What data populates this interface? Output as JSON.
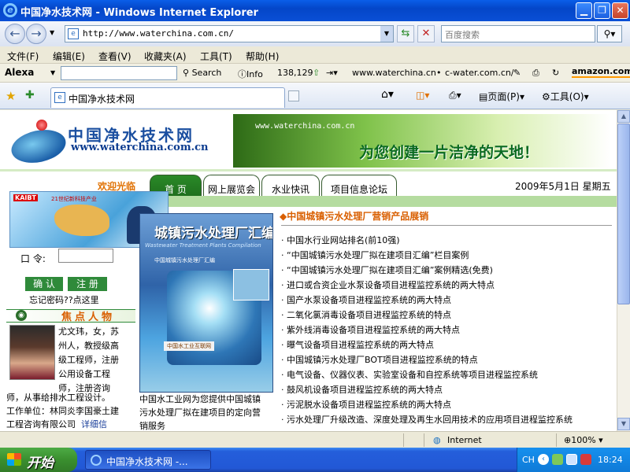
{
  "window": {
    "title": "中国净水技术网 - Windows Internet Explorer",
    "minimize_icon": "minimize-icon",
    "maximize_icon": "restore-icon",
    "close_icon": "close-icon"
  },
  "address": {
    "url": "http://www.waterchina.com.cn/",
    "search_placeholder": "百度搜索"
  },
  "menu": [
    "文件(F)",
    "编辑(E)",
    "查看(V)",
    "收藏夹(A)",
    "工具(T)",
    "帮助(H)"
  ],
  "alexa_bar": {
    "brand": "Alexa",
    "search_label": "Search",
    "info_label": "Info",
    "rank": "138,129",
    "site1": "www.waterchina.cn",
    "site2": "c-water.com.cn/",
    "amazon": "amazon.com."
  },
  "tabs": [
    {
      "label": "中国净水技术网",
      "active": true
    }
  ],
  "command_bar": {
    "page": "页面(P)",
    "tools": "工具(O)"
  },
  "page": {
    "logo_cn": "中国净水技术网",
    "logo_en": "www.waterchina.com.cn",
    "banner_url": "www.waterchina.com.cn",
    "banner_slogan": "为您创建一片洁净的天地！",
    "welcome": "欢迎光临",
    "nav": [
      "首 页",
      "网上展览会",
      "水业快讯",
      "项目信息论坛"
    ],
    "date": "2009年5月1日  星期五",
    "ad": {
      "tag": "KAIBT",
      "text": "21世纪新科技产业"
    },
    "login": {
      "password_label": "口  令:",
      "confirm": "确 认",
      "register": "注 册",
      "forgot": "忘记密码??点这里"
    },
    "focus_title": "焦点人物",
    "bio_lines": [
      "尤文玮，女，苏",
      "州人，教授级高",
      "级工程师，注册",
      "公用设备工程",
      "师，注册咨询"
    ],
    "bio_rest": [
      "师，从事给排水工程设计。",
      "工作单位：林同炎李国豪土建",
      "工程咨询有限公司"
    ],
    "bio_more": "详细信",
    "cover": {
      "title": "城镇污水处理厂汇编",
      "subtitle": "Wastewater Treatment Plants Compilation",
      "org": "中国城镇污水处理厂汇编",
      "foot": "中国水工业互联网"
    },
    "cover_caption": [
      "中国水工业网为您提供中国城镇",
      "污水处理厂拟在建项目的定向营",
      "销服务"
    ],
    "products_title": "◆中国城镇污水处理厂营销产品展销",
    "news": [
      "· 中国水行业网站排名(前10强)",
      "· “中国城镇污水处理厂拟在建项目汇编”栏目案例",
      "· “中国城镇污水处理厂拟在建项目汇编”案例精选(免费)",
      "· 进口或合资企业水泵设备项目进程监控系统的两大特点",
      "· 国产水泵设备项目进程监控系统的两大特点",
      "· 二氧化氯消毒设备项目进程监控系统的特点",
      "· 紫外线消毒设备项目进程监控系统的两大特点",
      "· 曝气设备项目进程监控系统的两大特点",
      "· 中国城镇污水处理厂BOT项目进程监控系统的特点",
      "· 电气设备、仪器仪表、实验室设备和自控系统等项目进程监控系统",
      "· 鼓风机设备项目进程监控系统的两大特点",
      "· 污泥脱水设备项目进程监控系统的两大特点",
      "· 污水处理厂升级改造、深度处理及再生水回用技术的应用项目进程监控系统"
    ]
  },
  "status": {
    "zone": "Internet",
    "zoom": "100%"
  },
  "taskbar": {
    "start": "开始",
    "task": "中国净水技术网 -...",
    "ime": "CH",
    "clock": "18:24"
  }
}
